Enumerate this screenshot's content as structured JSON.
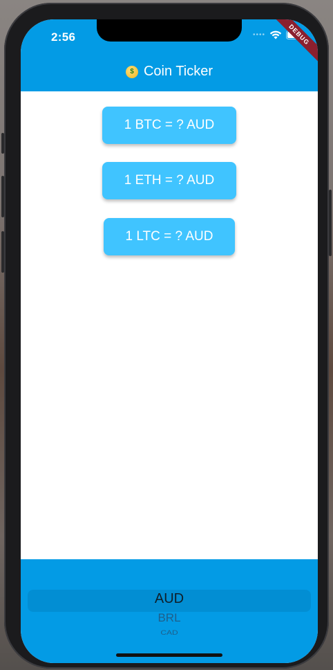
{
  "status_bar": {
    "time": "2:56",
    "debug_label": "DEBUG"
  },
  "app_bar": {
    "title": "Coin Ticker",
    "title_icon": "money-mouth-face-icon"
  },
  "rates": [
    {
      "label": "1 BTC = ? AUD"
    },
    {
      "label": "1 ETH = ? AUD"
    },
    {
      "label": "1 LTC = ? AUD"
    }
  ],
  "currency_picker": {
    "selected": "AUD",
    "options_visible": [
      "AUD",
      "BRL",
      "CAD"
    ]
  },
  "colors": {
    "app_bar": "#039be5",
    "card": "#40c4ff",
    "debug_banner": "#8b1f2e"
  }
}
